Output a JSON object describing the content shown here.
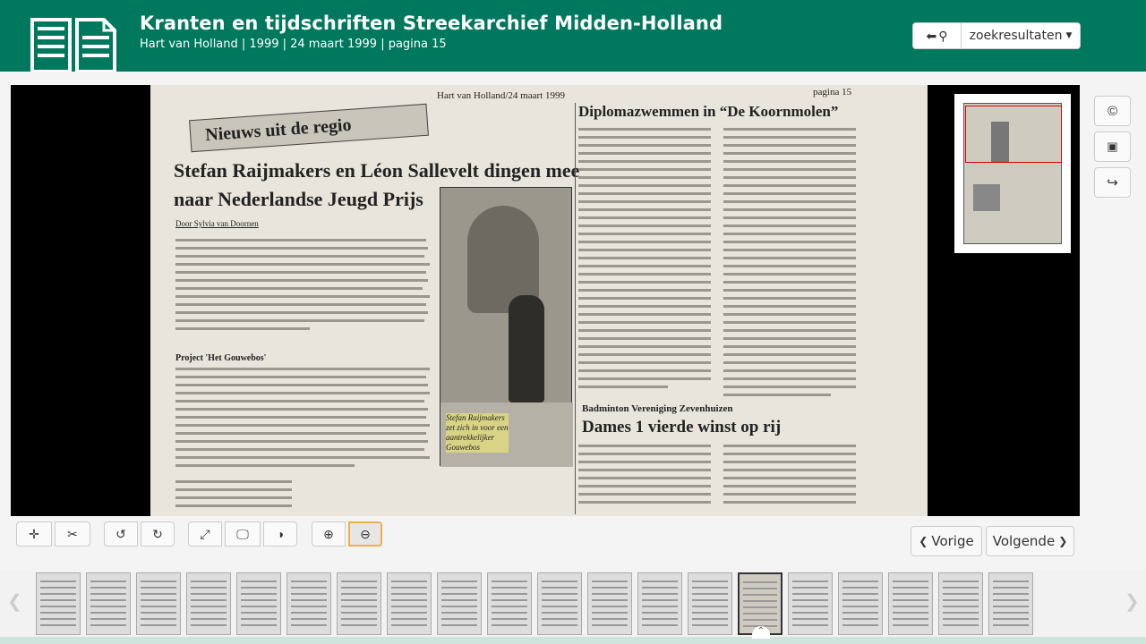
{
  "header": {
    "title": "Kranten en tijdschriften Streekarchief Midden-Holland",
    "subtitle": "Hart van Holland | 1999 | 24 maart 1999 | pagina 15",
    "results_label": "zoekresultaten"
  },
  "newspaper": {
    "masthead": "Hart van Holland/24 maart 1999",
    "page_label": "pagina 15",
    "section": "Nieuws uit de regio",
    "headline": "Stefan Raijmakers en Léon Sallevelt dingen mee naar Nederlandse Jeugd Prijs",
    "byline": "Door Sylvia van Doornen",
    "subhead": "Project 'Het Gouwebos'",
    "caption": "Stefan Raijmakers zet zich in voor een aantrekkelijker Gouwebos",
    "right_title": "Diplomazwemmen in “De Koornmolen”",
    "badminton_kicker": "Badminton Vereniging Zevenhuizen",
    "badminton_title": "Dames 1 vierde winst op rij"
  },
  "controls": {
    "prev_label": "Vorige",
    "next_label": "Volgende"
  },
  "colors": {
    "header_bg": "#00785d",
    "highlight": "#f5f06a",
    "active_border": "#f0ad4e"
  },
  "thumbnails": {
    "count": 20,
    "current_index": 14
  }
}
